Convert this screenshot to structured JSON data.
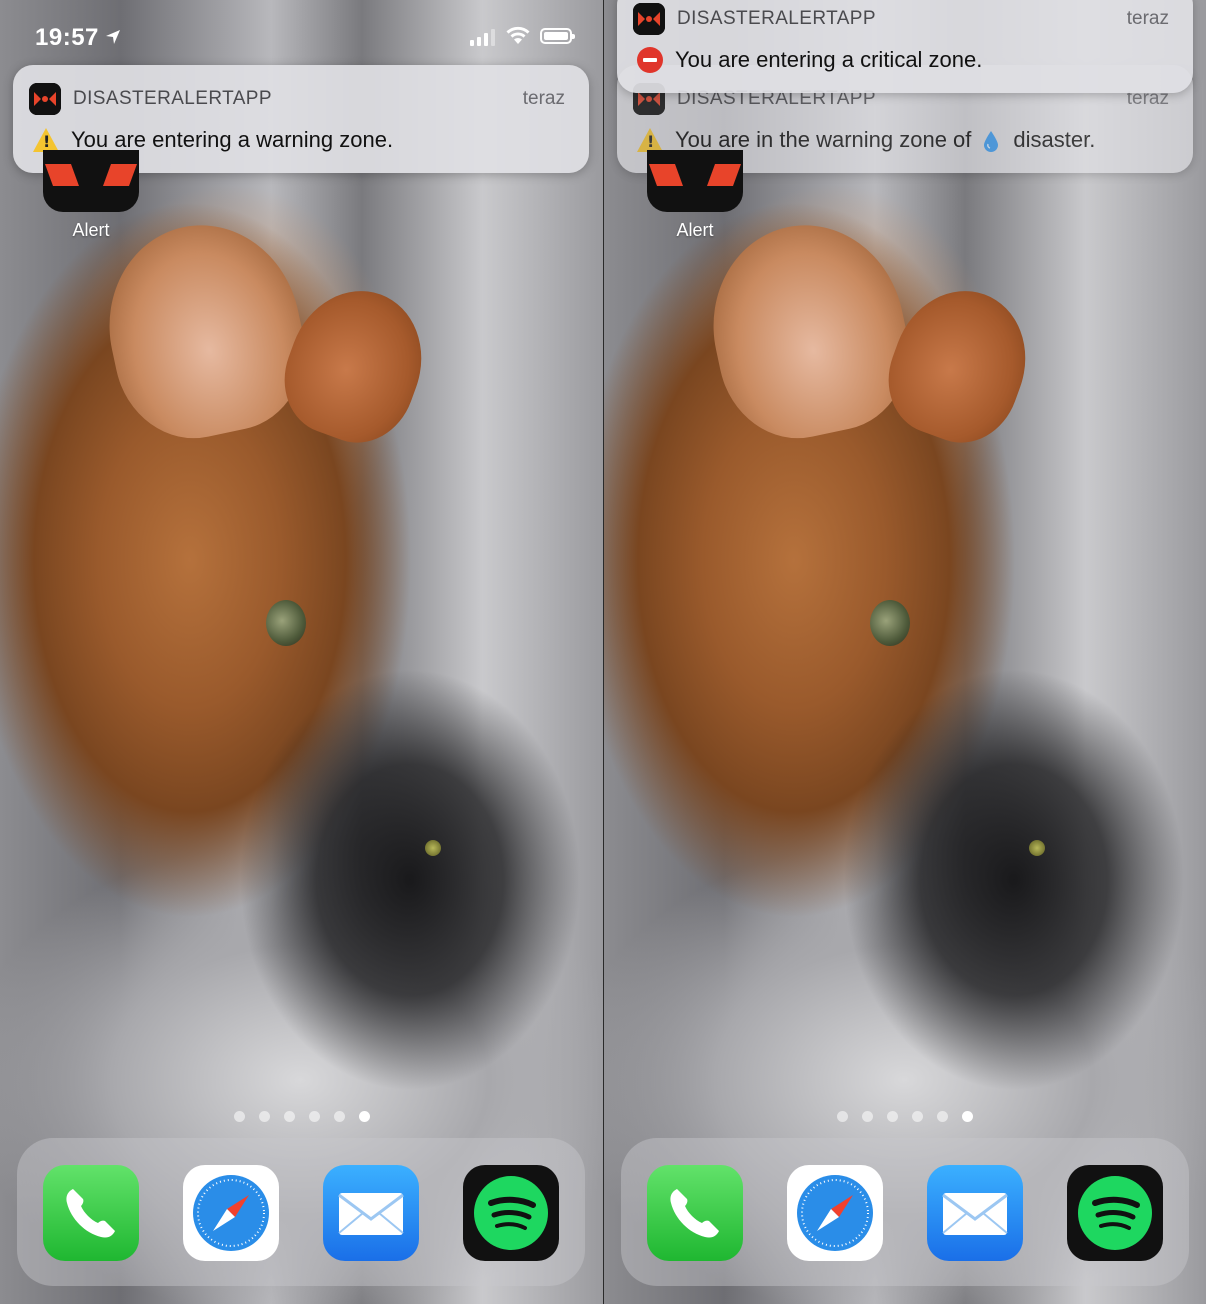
{
  "screens": [
    {
      "status": {
        "time": "19:57"
      },
      "notification": {
        "app_name": "DISASTERALERTAPP",
        "time": "teraz",
        "message": "You are entering a warning zone."
      },
      "home_app": {
        "label": "Alert"
      },
      "page_dots": {
        "count": 6,
        "active_index": 5
      },
      "dock": [
        "phone-icon",
        "safari-icon",
        "mail-icon",
        "spotify-icon"
      ]
    },
    {
      "notification_top": {
        "app_name": "DISASTERALERTAPP",
        "time": "teraz",
        "message": "You are entering a critical zone."
      },
      "notification_under": {
        "app_name": "DISASTERALERTAPP",
        "time": "teraz",
        "message_before": "You are in the warning zone of",
        "message_after": "disaster."
      },
      "home_app": {
        "label": "Alert"
      },
      "page_dots": {
        "count": 6,
        "active_index": 5
      },
      "dock": [
        "phone-icon",
        "safari-icon",
        "mail-icon",
        "spotify-icon"
      ]
    }
  ],
  "colors": {
    "alert_red": "#e8442a",
    "warning_yellow": "#f4c430",
    "critical_red": "#e0352b",
    "water_blue": "#3a9bf0"
  }
}
